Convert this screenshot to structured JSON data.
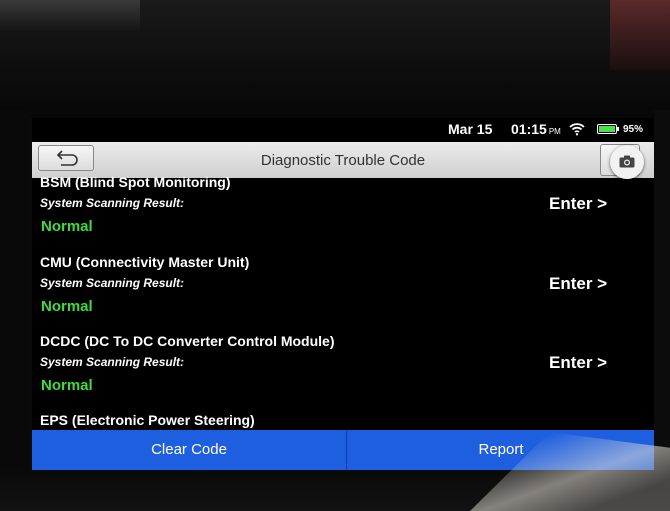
{
  "status_bar": {
    "date": "Mar 15",
    "time": "01:15",
    "ampm": "PM",
    "wifi_icon": "wifi-icon",
    "battery_icon": "battery-icon",
    "battery_percent": "95%",
    "battery_level": 0.95
  },
  "header": {
    "title": "Diagnostic Trouble Code",
    "back_icon": "back-arrow-icon",
    "camera_icon": "camera-icon"
  },
  "systems": [
    {
      "name": "BSM (Blind Spot Monitoring)",
      "result_label": "System Scanning Result:",
      "status": "Normal",
      "action": "Enter >"
    },
    {
      "name": "CMU (Connectivity Master Unit)",
      "result_label": "System Scanning Result:",
      "status": "Normal",
      "action": "Enter >"
    },
    {
      "name": "DCDC (DC To DC Converter Control Module)",
      "result_label": "System Scanning Result:",
      "status": "Normal",
      "action": "Enter >"
    },
    {
      "name": "EPS (Electronic Power Steering)"
    }
  ],
  "footer": {
    "clear_code": "Clear Code",
    "report": "Report"
  },
  "colors": {
    "status_normal": "#3fdc3f",
    "action_bar": "#1e5fe0",
    "title_bar": "#dcdcdc"
  }
}
